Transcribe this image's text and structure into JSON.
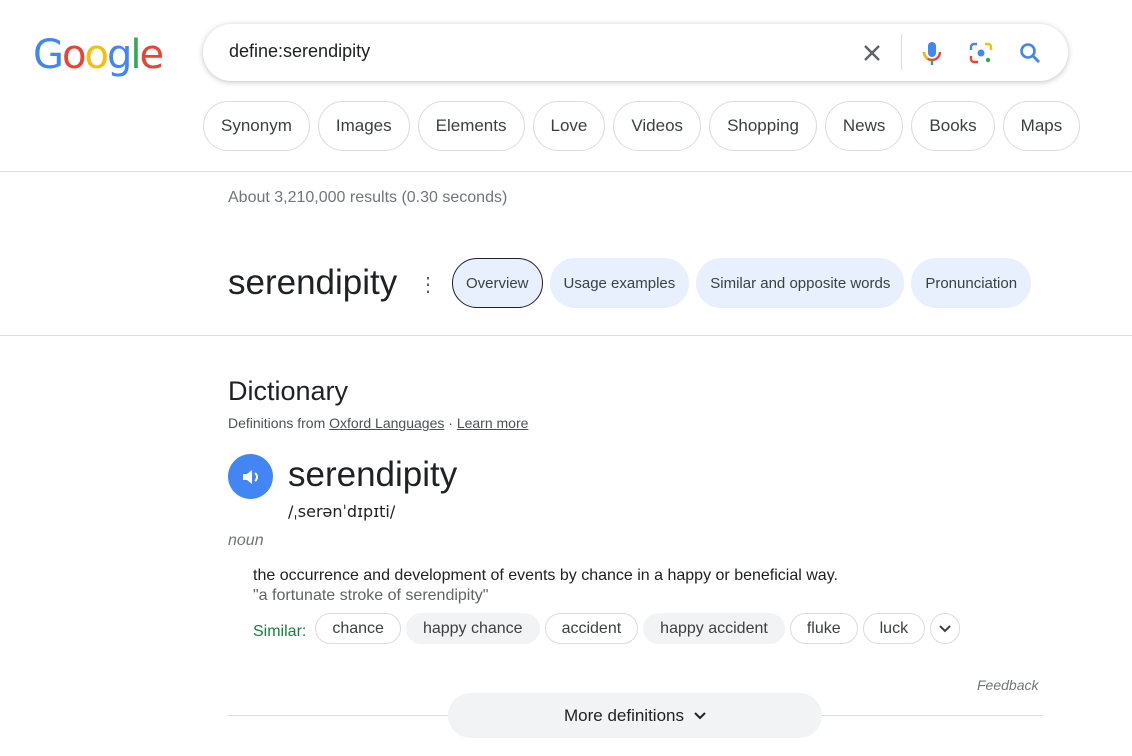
{
  "logo": {
    "text": "Google",
    "colors": [
      "#4285f4",
      "#ea4335",
      "#fbbc05",
      "#4285f4",
      "#34a853",
      "#ea4335"
    ]
  },
  "search": {
    "value": "define:serendipity",
    "icons": [
      "close-icon",
      "microphone-icon",
      "lens-icon",
      "search-icon"
    ]
  },
  "chips": [
    "Synonym",
    "Images",
    "Elements",
    "Love",
    "Videos",
    "Shopping",
    "News",
    "Books",
    "Maps"
  ],
  "stats": "About 3,210,000 results (0.30 seconds)",
  "word": "serendipity",
  "tabs": [
    "Overview",
    "Usage examples",
    "Similar and opposite words",
    "Pronunciation"
  ],
  "dictionary": {
    "title": "Dictionary",
    "source_prefix": "Definitions from ",
    "source_link": "Oxford Languages",
    "sep": " · ",
    "learn_more": "Learn more",
    "headword": "serendipity",
    "phonetic": "/ˌserənˈdɪpɪti/",
    "pos": "noun",
    "definition": "the occurrence and development of events by chance in a happy or beneficial way.",
    "example": "\"a fortunate stroke of serendipity\"",
    "similar_label": "Similar:",
    "similar": [
      "chance",
      "happy chance",
      "accident",
      "happy accident",
      "fluke",
      "luck"
    ],
    "feedback": "Feedback",
    "more": "More definitions"
  },
  "accent": "#4285f4"
}
